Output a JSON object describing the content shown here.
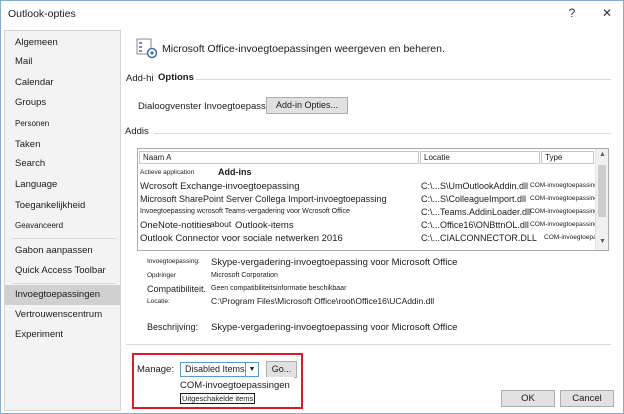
{
  "window": {
    "title": "Outlook-opties",
    "help": "?",
    "close": "✕"
  },
  "nav": {
    "items": [
      {
        "label": "Algemeen"
      },
      {
        "label": "Mail"
      },
      {
        "label": "Calendar"
      },
      {
        "label": "Groups"
      },
      {
        "label": "Personen"
      },
      {
        "label": "Taken"
      },
      {
        "label": "Search"
      },
      {
        "label": "Language"
      },
      {
        "label": "Toegankelijkheid"
      },
      {
        "label": "Geavanceerd"
      },
      {
        "label": "Gabon aanpassen"
      },
      {
        "label": "Quick Access Toolbar"
      },
      {
        "label": "Invoegtoepassingen"
      },
      {
        "label": "Vertrouwenscentrum"
      },
      {
        "label": "Experiment"
      }
    ],
    "active_index": 12
  },
  "header": {
    "text": "Microsoft Office-invoegtoepassingen weergeven en beheren.",
    "icon": "gear-addins-icon"
  },
  "options": {
    "prefix": "Add-hi",
    "heading": "Options",
    "dialog_label": "Dialoogvenster Invoegtoepassingsopties starten:",
    "button_label": "Add-in Opties..."
  },
  "addins": {
    "heading": "Addis",
    "columns": {
      "name": "Naam A",
      "location": "Locatie",
      "type": "Type"
    },
    "active_label": "Actieve application",
    "active_heading": "Add-ins",
    "rows": [
      {
        "name": "Wcrosoft Exchange-invoegtoepassing",
        "location": "C:\\...S\\UmOutlookAddin.dll",
        "type": "COM-invoegtoepassing"
      },
      {
        "name": "Microsoft SharePoint Server Collega Import-invoegtoepassing",
        "location": "C:\\...S\\ColleagueImport.dll",
        "type": "COM-invoegtoepassing"
      },
      {
        "name": "Invoegtoepassing wcrosoft Teams-vergadering voor Wcrosoft Office",
        "location": "C:\\...Teams.AddinLoader.dll",
        "type": "COM-invoegtoepassing"
      },
      {
        "name": "OneNote-notities",
        "name_extra": "about",
        "name_tail": "Outlook-items",
        "location": "C:\\...Office16\\ONBttnOL.dll",
        "type": "COM-invoegtoepassing"
      },
      {
        "name": "Outlook Connector voor sociale netwerken 2016",
        "location": "C:\\...CIALCONNECTOR.DLL",
        "type": "COM-invoegtoepassing"
      }
    ]
  },
  "details": {
    "addin_label": "Invoegtoepassing:",
    "addin_value": "Skype-vergadering-invoegtoepassing voor Microsoft Office",
    "publisher_label": "Opdringer",
    "publisher_value": "Microsoft Corporation",
    "compat_label": "Compatibiliteit.",
    "compat_value": "Geen compatibiliteitsinformatie beschikbaar",
    "location_label": "Locatie:",
    "location_value": "C:\\Program Files\\Microsoft Office\\root\\Office16\\UCAddin.dll",
    "description_label": "Beschrijving:",
    "description_value": "Skype-vergadering-invoegtoepassing voor Microsoft Office"
  },
  "manage": {
    "label": "Manage:",
    "selected": "Disabled Items",
    "go_label": "Go...",
    "options": [
      "COM-invoegtoepassingen",
      "Uitgeschakelde items"
    ]
  },
  "footer": {
    "ok": "OK",
    "cancel": "Cancel"
  },
  "colors": {
    "highlight": "#d81e25",
    "select_border": "#5b9bd5",
    "nav_active": "#d0d0d0"
  }
}
